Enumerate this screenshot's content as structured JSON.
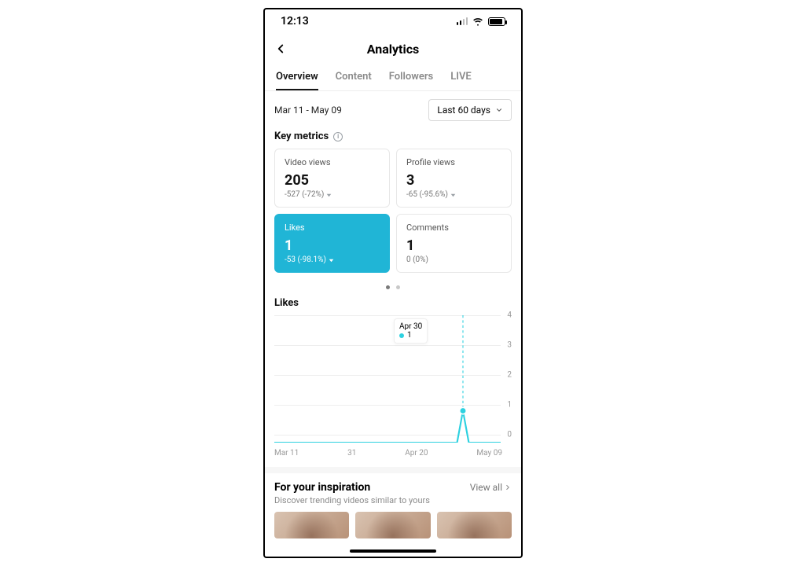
{
  "status": {
    "time": "12:13"
  },
  "header": {
    "title": "Analytics"
  },
  "tabs": [
    "Overview",
    "Content",
    "Followers",
    "LIVE"
  ],
  "active_tab": 0,
  "filter": {
    "range_label": "Mar 11 - May 09",
    "selector": "Last 60 days"
  },
  "section_metrics_title": "Key metrics",
  "metrics": [
    {
      "label": "Video views",
      "value": "205",
      "delta": "-527 (-72%)",
      "trend": "down",
      "selected": false
    },
    {
      "label": "Profile views",
      "value": "3",
      "delta": "-65 (-95.6%)",
      "trend": "down",
      "selected": false
    },
    {
      "label": "Likes",
      "value": "1",
      "delta": "-53 (-98.1%)",
      "trend": "down",
      "selected": true
    },
    {
      "label": "Comments",
      "value": "1",
      "delta": "0 (0%)",
      "trend": "flat",
      "selected": false
    }
  ],
  "pager": {
    "count": 2,
    "active": 0
  },
  "chart": {
    "title": "Likes",
    "y_ticks": [
      "4",
      "3",
      "2",
      "1",
      "0"
    ],
    "x_labels": [
      "Mar 11",
      "31",
      "Apr 20",
      "May 09"
    ],
    "tooltip": {
      "date": "Apr 30",
      "value": "1"
    }
  },
  "chart_data": {
    "type": "line",
    "title": "Likes",
    "xlabel": "",
    "ylabel": "",
    "ylim": [
      0,
      4
    ],
    "x_range": [
      "Mar 11",
      "May 09"
    ],
    "x_ticks": [
      "Mar 11",
      "Mar 31",
      "Apr 20",
      "May 09"
    ],
    "series": [
      {
        "name": "Likes",
        "color": "#2dd1e0",
        "points": [
          {
            "x": "Mar 11",
            "y": 0
          },
          {
            "x": "Mar 31",
            "y": 0
          },
          {
            "x": "Apr 20",
            "y": 0
          },
          {
            "x": "Apr 30",
            "y": 1
          },
          {
            "x": "May 09",
            "y": 0
          }
        ]
      }
    ],
    "highlight": {
      "x": "Apr 30",
      "y": 1
    }
  },
  "inspiration": {
    "title": "For your inspiration",
    "view_all": "View all",
    "subtitle": "Discover trending videos similar to yours"
  }
}
